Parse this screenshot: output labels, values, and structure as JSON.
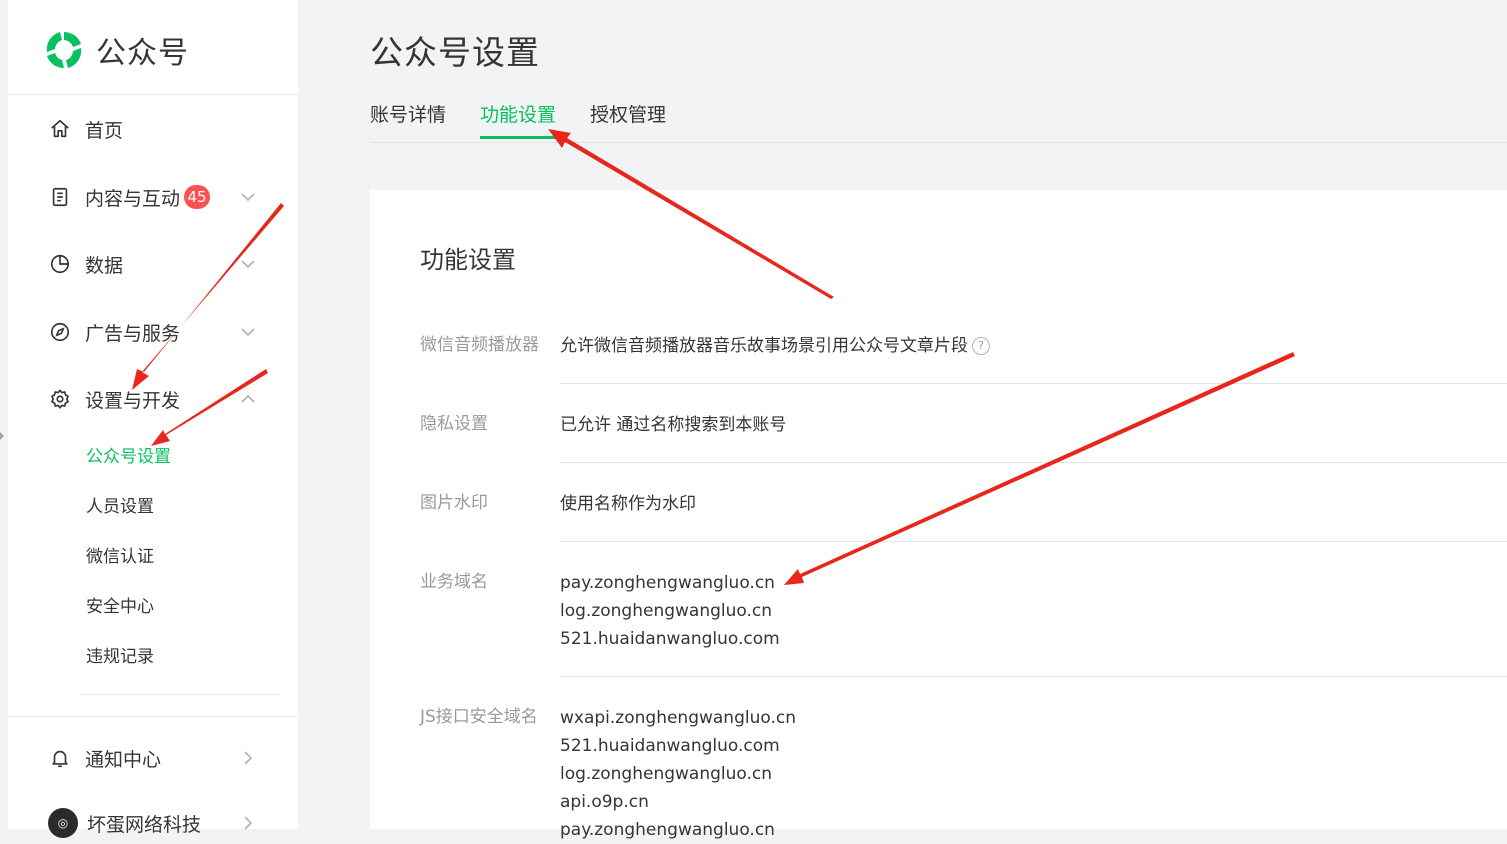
{
  "brand": {
    "name": "公众号"
  },
  "sidebar": {
    "items": [
      {
        "label": "首页"
      },
      {
        "label": "内容与互动",
        "badge": "45"
      },
      {
        "label": "数据"
      },
      {
        "label": "广告与服务"
      },
      {
        "label": "设置与开发"
      }
    ],
    "sub_items": [
      {
        "label": "公众号设置",
        "active": true
      },
      {
        "label": "人员设置"
      },
      {
        "label": "微信认证"
      },
      {
        "label": "安全中心"
      },
      {
        "label": "违规记录"
      }
    ],
    "notification": {
      "label": "通知中心"
    },
    "account": {
      "label": "坏蛋网络科技"
    }
  },
  "main": {
    "title": "公众号设置",
    "tabs": [
      {
        "label": "账号详情"
      },
      {
        "label": "功能设置",
        "active": true
      },
      {
        "label": "授权管理"
      }
    ],
    "card": {
      "title": "功能设置",
      "rows": [
        {
          "label": "微信音频播放器",
          "value": "允许微信音频播放器音乐故事场景引用公众号文章片段"
        },
        {
          "label": "隐私设置",
          "value": "已允许 通过名称搜索到本账号"
        },
        {
          "label": "图片水印",
          "value": "使用名称作为水印"
        },
        {
          "label": "业务域名",
          "values": [
            "pay.zonghengwangluo.cn",
            "log.zonghengwangluo.cn",
            "521.huaidanwangluo.com"
          ]
        },
        {
          "label": "JS接口安全域名",
          "values": [
            "wxapi.zonghengwangluo.cn",
            "521.huaidanwangluo.com",
            "log.zonghengwangluo.cn",
            "api.o9p.cn",
            "pay.zonghengwangluo.cn"
          ]
        }
      ]
    }
  },
  "colors": {
    "accent": "#07c160",
    "badge": "#fa5151",
    "annotation": "#e8261b"
  }
}
